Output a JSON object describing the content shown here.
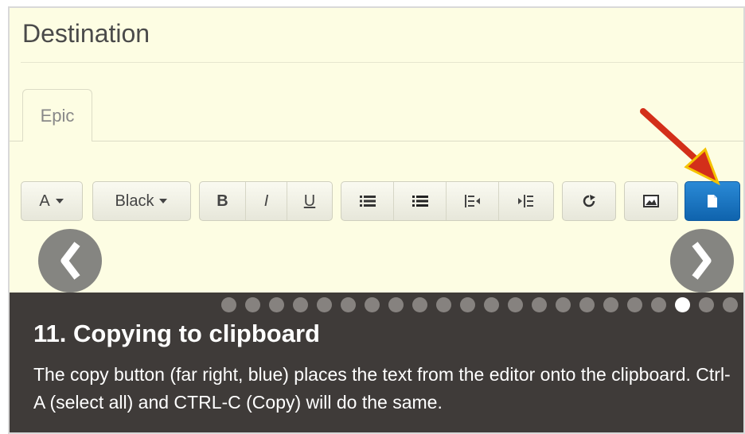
{
  "editor": {
    "heading": "Destination",
    "tab_label": "Epic",
    "toolbar": {
      "font_size_label": "A",
      "color_label": "Black",
      "bold_label": "B",
      "italic_label": "I",
      "underline_label": "U"
    }
  },
  "icons": [
    "chevron-left-icon",
    "chevron-right-icon",
    "caret-down-icon",
    "bullet-list-icon",
    "numbered-list-icon",
    "outdent-icon",
    "indent-icon",
    "share-icon",
    "image-icon",
    "copy-icon",
    "red-arrow-icon"
  ],
  "slideshow": {
    "caption_title": "11. Copying to clipboard",
    "caption_text": "The copy button (far right, blue) places the text from the editor onto the clipboard. Ctrl-A (select all) and CTRL-C (Copy) will do the same.",
    "total_slides": 22,
    "current_slide": 20
  },
  "colors": {
    "editor_background": "#fdfde3",
    "copy_button": "#1a73c4",
    "caption_background": "#3f3b39",
    "arrow": "#d32f1a"
  }
}
